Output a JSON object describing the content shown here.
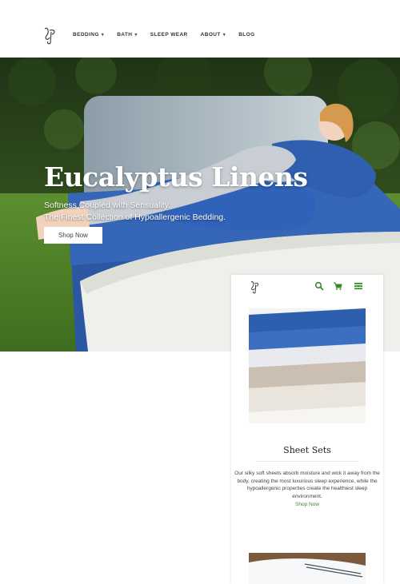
{
  "brand": {
    "logo_text": "LF"
  },
  "nav": {
    "items": [
      {
        "label": "BEDDING",
        "has_dropdown": true
      },
      {
        "label": "BATH",
        "has_dropdown": true
      },
      {
        "label": "SLEEP WEAR",
        "has_dropdown": false
      },
      {
        "label": "ABOUT",
        "has_dropdown": true
      },
      {
        "label": "BLOG",
        "has_dropdown": false
      }
    ],
    "chevron": "⌄"
  },
  "hero": {
    "title": "Eucalyptus Linens",
    "subtitle_line1": "Softness Coupled with Sensuality.",
    "subtitle_line2": "The Finest Collection of Hypoallergenic Bedding.",
    "button_label": "Shop Now"
  },
  "mobile": {
    "icons": [
      "search-icon",
      "cart-icon",
      "menu-icon"
    ],
    "accent_color": "#3a8a2c",
    "product_title": "Sheet Sets",
    "product_desc": "Our silky soft sheets absorb moisture and wick it away from the body, creating the most luxurious sleep experience, while the hypoallergenic properties create the healthiest sleep environment.",
    "product_link": "Shop Now"
  }
}
